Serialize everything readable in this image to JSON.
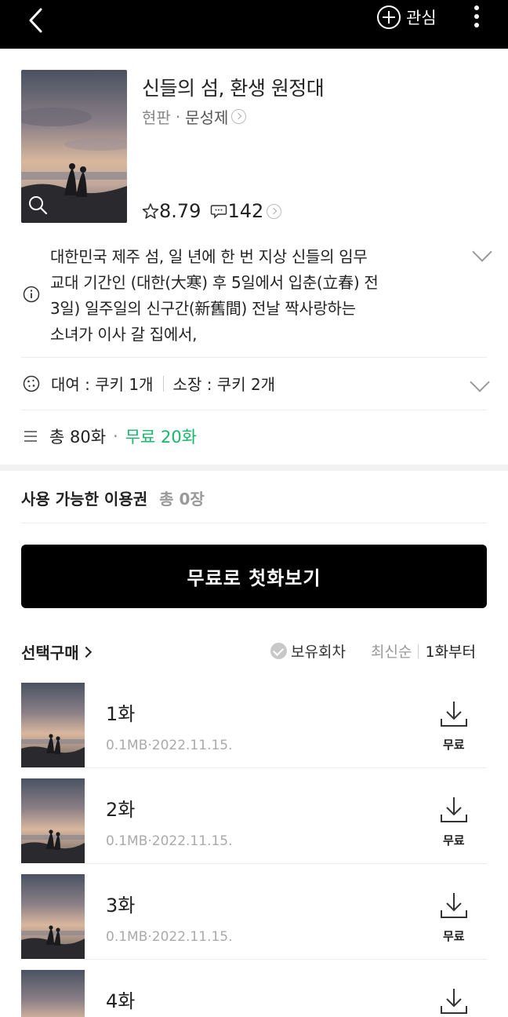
{
  "header": {
    "favorite_label": "관심"
  },
  "book": {
    "title": "신들의 섬, 환생 원정대",
    "publisher": "현판",
    "author": "문성제",
    "rating": "8.79",
    "comment_count": "142",
    "cover_icon": "magnifier-icon"
  },
  "description": {
    "lines": [
      "대한민국 제주 섬, 일 년에 한 번 지상 신들의 임무",
      "교대 기간인 (대한(大寒) 후 5일에서 입춘(立春) 전",
      "3일) 일주일의 신구간(新舊間) 전날 짝사랑하는",
      "소녀가 이사 갈 집에서,"
    ]
  },
  "pricing": {
    "rent": "대여 : 쿠키 1개",
    "own": "소장 : 쿠키 2개"
  },
  "episodes_summary": {
    "total": "총 80화",
    "free": "무료 20화"
  },
  "ticket": {
    "label": "사용 가능한 이용권",
    "count": "총 0장"
  },
  "cta_label": "무료로 첫화보기",
  "list_controls": {
    "select_buy": "선택구매",
    "owned_filter": "보유회차",
    "sort_latest": "최신순",
    "sort_first": "1화부터"
  },
  "episodes": [
    {
      "title": "1화",
      "meta": "0.1MB·2022.11.15.",
      "price": "무료"
    },
    {
      "title": "2화",
      "meta": "0.1MB·2022.11.15.",
      "price": "무료"
    },
    {
      "title": "3화",
      "meta": "0.1MB·2022.11.15.",
      "price": "무료"
    },
    {
      "title": "4화",
      "meta": "",
      "price": ""
    }
  ],
  "colors": {
    "accent_free": "#16b86a",
    "topbar": "#000000",
    "cta": "#000000"
  }
}
